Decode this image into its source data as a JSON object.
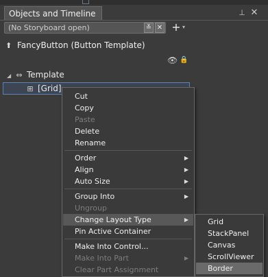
{
  "panel": {
    "tab_title": "Objects and Timeline",
    "pin_glyph": "⊥",
    "close_glyph": "✕"
  },
  "storyboard": {
    "value": "(No Storyboard open)",
    "dropdown_glyph": "≚",
    "close_glyph": "✕",
    "add_glyph": "+",
    "add_menu_glyph": "▾"
  },
  "template_header": {
    "icon": "up-arrow-icon",
    "icon_glyph": "⬆",
    "title": "FancyButton (Button Template)"
  },
  "tree": {
    "template": {
      "label": "Template",
      "expand_glyph": "◢",
      "icon_glyph": "⇔"
    },
    "grid": {
      "label": "[Grid]",
      "icon_glyph": "⊞"
    }
  },
  "icons": {
    "eye": "👁",
    "lock": "🔒"
  },
  "context_menu": {
    "items": [
      {
        "label": "Cut"
      },
      {
        "label": "Copy"
      },
      {
        "label": "Paste"
      },
      {
        "label": "Delete"
      },
      {
        "label": "Rename"
      },
      {
        "label": "Order"
      },
      {
        "label": "Align"
      },
      {
        "label": "Auto Size"
      },
      {
        "label": "Group Into"
      },
      {
        "label": "Ungroup"
      },
      {
        "label": "Change Layout Type"
      },
      {
        "label": "Pin Active Container"
      },
      {
        "label": "Make Into Control..."
      },
      {
        "label": "Make Into Part"
      },
      {
        "label": "Clear Part Assignment"
      }
    ],
    "submenu_glyph": "▶"
  },
  "layout_submenu": {
    "items": [
      "Grid",
      "StackPanel",
      "Canvas",
      "ScrollViewer",
      "Border"
    ]
  }
}
